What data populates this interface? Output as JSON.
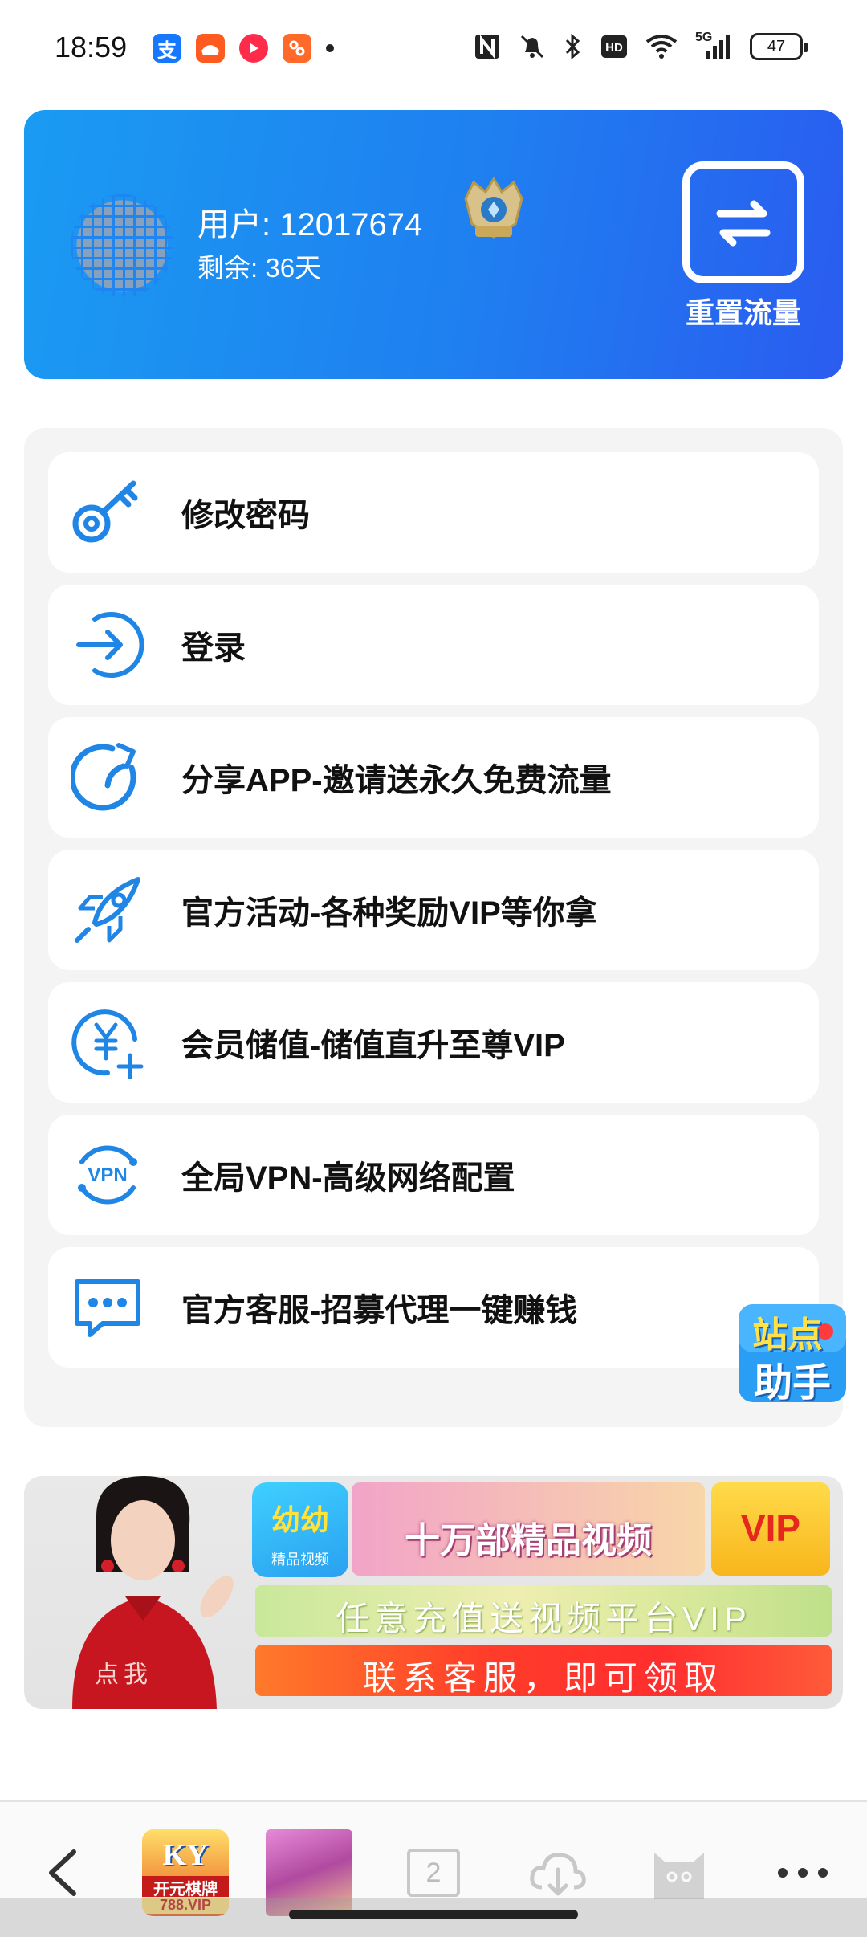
{
  "status_bar": {
    "time": "18:59",
    "battery": "47",
    "network": "5G",
    "hd_label": "HD",
    "nfc_label": "N",
    "notification_icons": [
      "alipay-icon",
      "taobao-icon",
      "video-icon",
      "app-icon"
    ]
  },
  "header": {
    "user_label": "用户: 12017674",
    "remaining_label": "剩余: 36天",
    "reset_button_label": "重置流量"
  },
  "menu": {
    "items": [
      {
        "label": "修改密码",
        "icon": "key-icon"
      },
      {
        "label": "登录",
        "icon": "login-icon"
      },
      {
        "label": "分享APP-邀请送永久免费流量",
        "icon": "share-icon"
      },
      {
        "label": "官方活动-各种奖励VIP等你拿",
        "icon": "rocket-icon"
      },
      {
        "label": "会员储值-储值直升至尊VIP",
        "icon": "yuan-add-icon"
      },
      {
        "label": "全局VPN-高级网络配置",
        "icon": "vpn-icon"
      },
      {
        "label": "官方客服-招募代理一键赚钱",
        "icon": "chat-icon"
      }
    ]
  },
  "floating_helper": {
    "line1": "站点",
    "line2": "助手"
  },
  "banner": {
    "click_text": "点我",
    "app_name": "幼幼",
    "app_sub": "精品视频",
    "title": "十万部精品视频",
    "vip": "VIP",
    "line1": "任意充值送视频平台VIP",
    "line2": "联系客服，即可领取"
  },
  "bottom_nav": {
    "tab_count": "2",
    "thumb1_label": "开元棋牌",
    "thumb1_tag": "788.VIP",
    "thumb1_logo": "KY"
  },
  "colors": {
    "header_gradient_start": "#1a9bf2",
    "header_gradient_end": "#2a5cf0",
    "icon_blue": "#1f86e6",
    "panel_bg": "#f4f4f4"
  }
}
